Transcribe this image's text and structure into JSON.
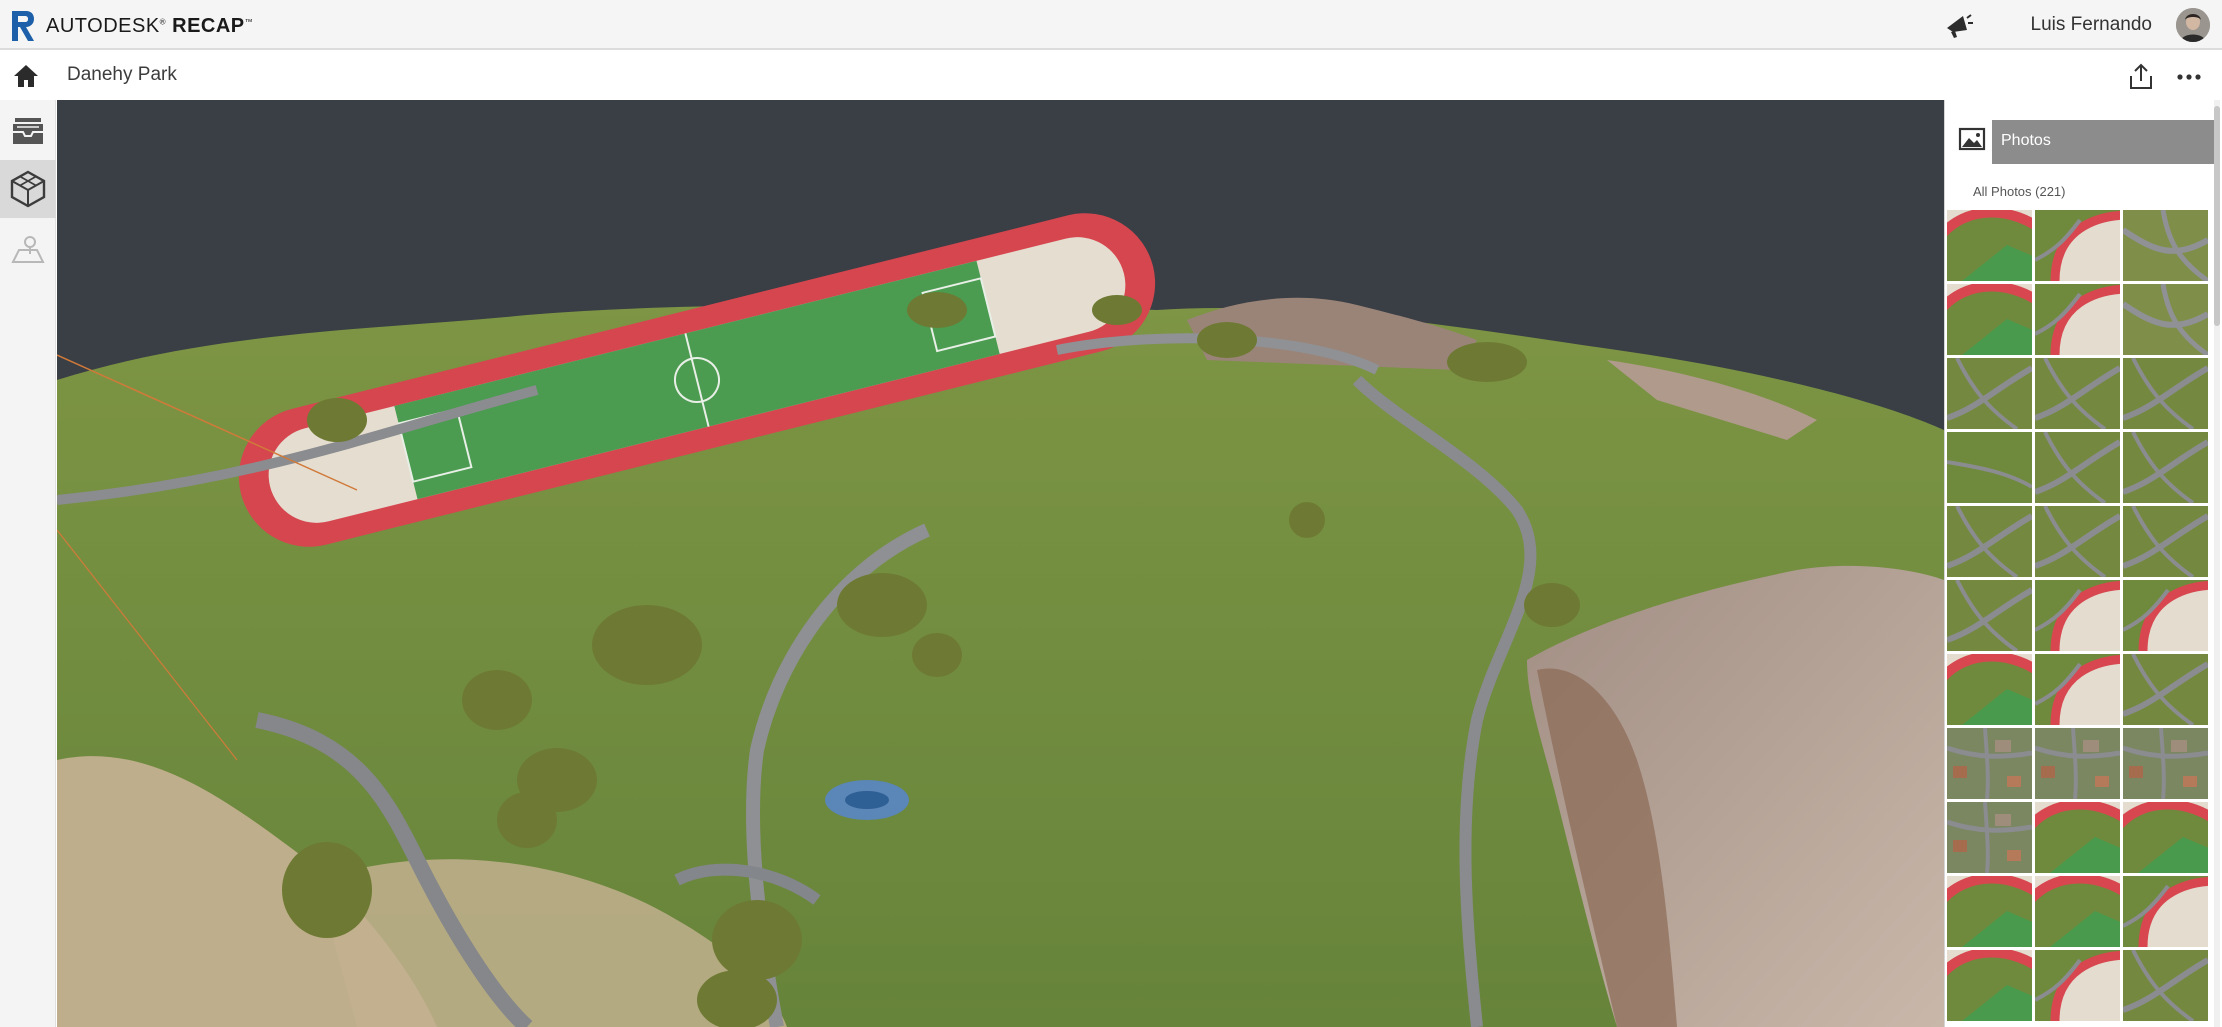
{
  "app": {
    "brand_prefix": "AUTODESK",
    "brand_suffix": "RECAP",
    "user_name": "Luis Fernando"
  },
  "project": {
    "title": "Danehy Park"
  },
  "left_rail": {
    "items": [
      {
        "name": "data-icon",
        "active": false
      },
      {
        "name": "3d-model-icon",
        "active": true
      },
      {
        "name": "map-icon",
        "active": false
      }
    ]
  },
  "panel": {
    "tab_label": "Photos",
    "subtitle": "All Photos (221)",
    "thumbnails": [
      "track-field",
      "track-curve",
      "road-curve",
      "track-field",
      "track-curve",
      "road-curve",
      "road-grass",
      "road-grass",
      "road-grass",
      "grass",
      "road-grass",
      "road-grass",
      "road-grass",
      "road-grass",
      "road-grass",
      "road-grass",
      "track-curve",
      "track-curve",
      "track-field",
      "track-curve",
      "road-grass",
      "houses",
      "houses",
      "houses",
      "houses",
      "track-field",
      "track-field",
      "track-field",
      "track-field",
      "track-curve",
      "track-field",
      "track-curve",
      "road-grass"
    ]
  },
  "colors": {
    "sky": "#3a3e45",
    "grass": "#6f8a3c",
    "track": "#d8474f",
    "field": "#4a9a4e",
    "sand": "#e3dccf",
    "panel_tab": "#8c8c8c"
  }
}
